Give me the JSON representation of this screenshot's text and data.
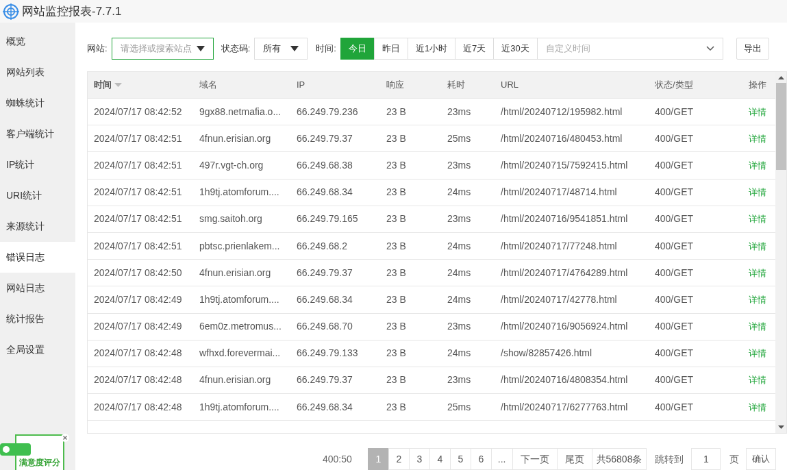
{
  "window": {
    "title": "网站监控报表-7.7.1"
  },
  "sidebar": {
    "items": [
      {
        "label": "概览",
        "selected": false
      },
      {
        "label": "网站列表",
        "selected": false
      },
      {
        "label": "蜘蛛统计",
        "selected": false
      },
      {
        "label": "客户端统计",
        "selected": false
      },
      {
        "label": "IP统计",
        "selected": false
      },
      {
        "label": "URI统计",
        "selected": false
      },
      {
        "label": "来源统计",
        "selected": false
      },
      {
        "label": "错误日志",
        "selected": true
      },
      {
        "label": "网站日志",
        "selected": false
      },
      {
        "label": "统计报告",
        "selected": false
      },
      {
        "label": "全局设置",
        "selected": false
      }
    ]
  },
  "filters": {
    "site_label": "网站:",
    "site_placeholder": "请选择或搜索站点",
    "status_label": "状态码:",
    "status_value": "所有",
    "time_label": "时间:",
    "time_tabs": [
      {
        "label": "今日",
        "selected": true
      },
      {
        "label": "昨日",
        "selected": false
      },
      {
        "label": "近1小时",
        "selected": false
      },
      {
        "label": "近7天",
        "selected": false
      },
      {
        "label": "近30天",
        "selected": false
      }
    ],
    "custom_placeholder": "自定义时间",
    "export": "导出"
  },
  "table": {
    "columns": [
      "时间",
      "域名",
      "IP",
      "响应",
      "耗时",
      "URL",
      "状态/类型",
      "操作"
    ],
    "rows": [
      [
        "2024/07/17 08:42:52",
        "9gx88.netmafia.o...",
        "66.249.79.236",
        "23 B",
        "23ms",
        "/html/20240712/195982.html",
        "400/GET",
        "详情"
      ],
      [
        "2024/07/17 08:42:51",
        "4fnun.erisian.org",
        "66.249.79.37",
        "23 B",
        "25ms",
        "/html/20240716/480453.html",
        "400/GET",
        "详情"
      ],
      [
        "2024/07/17 08:42:51",
        "497r.vgt-ch.org",
        "66.249.68.38",
        "23 B",
        "23ms",
        "/html/20240715/7592415.html",
        "400/GET",
        "详情"
      ],
      [
        "2024/07/17 08:42:51",
        "1h9tj.atomforum....",
        "66.249.68.34",
        "23 B",
        "24ms",
        "/html/20240717/48714.html",
        "400/GET",
        "详情"
      ],
      [
        "2024/07/17 08:42:51",
        "smg.saitoh.org",
        "66.249.79.165",
        "23 B",
        "23ms",
        "/html/20240716/9541851.html",
        "400/GET",
        "详情"
      ],
      [
        "2024/07/17 08:42:51",
        "pbtsc.prienlakem...",
        "66.249.68.2",
        "23 B",
        "24ms",
        "/html/20240717/77248.html",
        "400/GET",
        "详情"
      ],
      [
        "2024/07/17 08:42:50",
        "4fnun.erisian.org",
        "66.249.79.37",
        "23 B",
        "24ms",
        "/html/20240717/4764289.html",
        "400/GET",
        "详情"
      ],
      [
        "2024/07/17 08:42:49",
        "1h9tj.atomforum....",
        "66.249.68.34",
        "23 B",
        "24ms",
        "/html/20240717/42778.html",
        "400/GET",
        "详情"
      ],
      [
        "2024/07/17 08:42:49",
        "6em0z.metromus...",
        "66.249.68.70",
        "23 B",
        "23ms",
        "/html/20240716/9056924.html",
        "400/GET",
        "详情"
      ],
      [
        "2024/07/17 08:42:48",
        "wfhxd.forevermai...",
        "66.249.79.133",
        "23 B",
        "24ms",
        "/show/82857426.html",
        "400/GET",
        "详情"
      ],
      [
        "2024/07/17 08:42:48",
        "4fnun.erisian.org",
        "66.249.79.37",
        "23 B",
        "23ms",
        "/html/20240716/4808354.html",
        "400/GET",
        "详情"
      ],
      [
        "2024/07/17 08:42:48",
        "1h9tj.atomforum....",
        "66.249.68.34",
        "23 B",
        "25ms",
        "/html/20240717/6277763.html",
        "400/GET",
        "详情"
      ]
    ]
  },
  "pagination": {
    "summary": "400:50",
    "pages": [
      {
        "label": "1",
        "selected": true
      },
      {
        "label": "2",
        "selected": false
      },
      {
        "label": "3",
        "selected": false
      },
      {
        "label": "4",
        "selected": false
      },
      {
        "label": "5",
        "selected": false
      },
      {
        "label": "6",
        "selected": false
      },
      {
        "label": "...",
        "selected": false
      }
    ],
    "next": "下一页",
    "last": "尾页",
    "total": "共56808条",
    "jump_label": "跳转到",
    "jump_value": "1",
    "page_unit": "页",
    "confirm": "确认"
  },
  "rating_widget": {
    "label": "满意度评分"
  }
}
